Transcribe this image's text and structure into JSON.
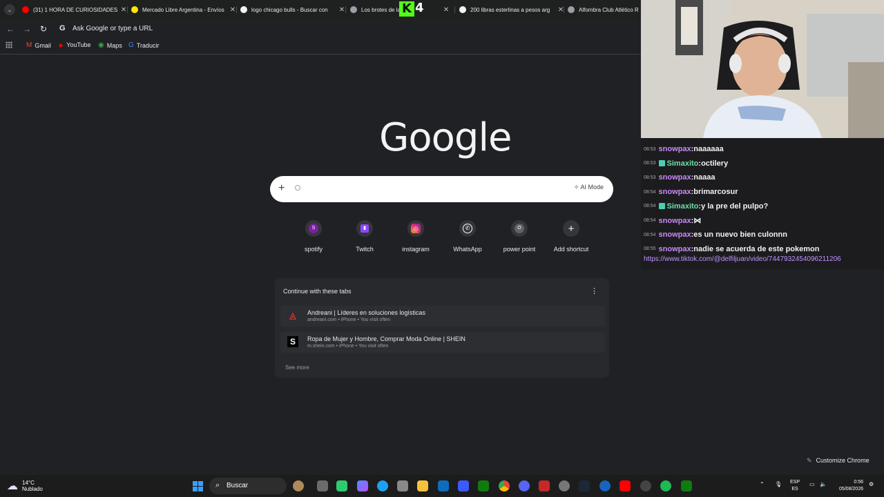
{
  "tabs": [
    {
      "title": "(31) 1 HORA DE CURIOSIDADES",
      "favicon_color": "#ff0000"
    },
    {
      "title": "Mercado Libre Argentina - Envíos",
      "favicon_color": "#ffe600"
    },
    {
      "title": "logo chicago bulls - Buscar con",
      "favicon_color": "#4285f4"
    },
    {
      "title": "Los brotes de la",
      "favicon_color": "#4285f4"
    },
    {
      "title": "200 libras esterlinas a pesos arg",
      "favicon_color": "#4285f4"
    },
    {
      "title": "Alfombra Club Atlético R",
      "favicon_color": "#9aa0a6"
    }
  ],
  "overlay_logo": {
    "k": "K",
    "four": "4"
  },
  "toolbar": {
    "omnibox_placeholder": "Ask Google or type a URL",
    "omnibox_g": "G"
  },
  "bookmarks": [
    {
      "label": "Gmail",
      "color": "#ea4335",
      "glyph": "M"
    },
    {
      "label": "YouTube",
      "color": "#ff0000",
      "glyph": "▶"
    },
    {
      "label": "Maps",
      "color": "#34a853",
      "glyph": "◉"
    },
    {
      "label": "Traducir",
      "color": "#4285f4",
      "glyph": "G"
    }
  ],
  "ntp": {
    "logo": "Google",
    "ai_mode": "AI Mode",
    "shortcuts": [
      {
        "label": "spotify",
        "glyph": "S",
        "color": "#7b1fa2"
      },
      {
        "label": "Twitch",
        "glyph": "▮",
        "color": "#35363a"
      },
      {
        "label": "instagram",
        "glyph": "◎",
        "color": "#e1306c"
      },
      {
        "label": "WhatsApp",
        "glyph": "✆",
        "color": "#35363a"
      },
      {
        "label": "power point",
        "glyph": "O",
        "color": "#5f6368"
      },
      {
        "label": "Add shortcut",
        "glyph": "+",
        "color": "#35363a"
      }
    ],
    "continue": {
      "heading": "Continue with these tabs",
      "items": [
        {
          "title": "Andreani | Líderes en soluciones logísticas",
          "sub": "andreani.com • iPhone • You visit often",
          "glyph": "◬",
          "color": "#e53935"
        },
        {
          "title": "Ropa de Mujer y Hombre, Comprar Moda Online | SHEIN",
          "sub": "m.shein.com • iPhone • You visit often",
          "glyph": "S",
          "color": "#000000"
        }
      ],
      "see_more": "See more"
    },
    "customize": "Customize Chrome"
  },
  "chat": {
    "messages": [
      {
        "time": "08:53",
        "user": "snowpax",
        "user_color": "#c88af8",
        "badge": false,
        "text": "naaaaaa"
      },
      {
        "time": "08:53",
        "user": "Simaxito",
        "user_color": "#6ee0a8",
        "badge": true,
        "text": "octilery"
      },
      {
        "time": "08:53",
        "user": "snowpax",
        "user_color": "#c88af8",
        "badge": false,
        "text": "naaaa"
      },
      {
        "time": "08:54",
        "user": "snowpax",
        "user_color": "#c88af8",
        "badge": false,
        "text": "brimarcosur"
      },
      {
        "time": "08:54",
        "user": "Simaxito",
        "user_color": "#6ee0a8",
        "badge": true,
        "text": "y la pre del pulpo?"
      },
      {
        "time": "08:54",
        "user": "snowpax",
        "user_color": "#c88af8",
        "badge": false,
        "text": "⋈"
      },
      {
        "time": "08:54",
        "user": "snowpax",
        "user_color": "#c88af8",
        "badge": false,
        "text": "es un nuevo bien culonnn"
      },
      {
        "time": "08:55",
        "user": "snowpax",
        "user_color": "#c88af8",
        "badge": false,
        "text": "nadie se acuerda de este pokemon"
      }
    ],
    "link": "https://www.tiktok.com/@delfiljuan/video/7447932454096211206"
  },
  "taskbar": {
    "weather_temp": "14°C",
    "weather_desc": "Nublado",
    "search_label": "Buscar",
    "lang_top": "ESP",
    "lang_bottom": "ES",
    "time": "0:56",
    "date": "05/08/2026"
  }
}
